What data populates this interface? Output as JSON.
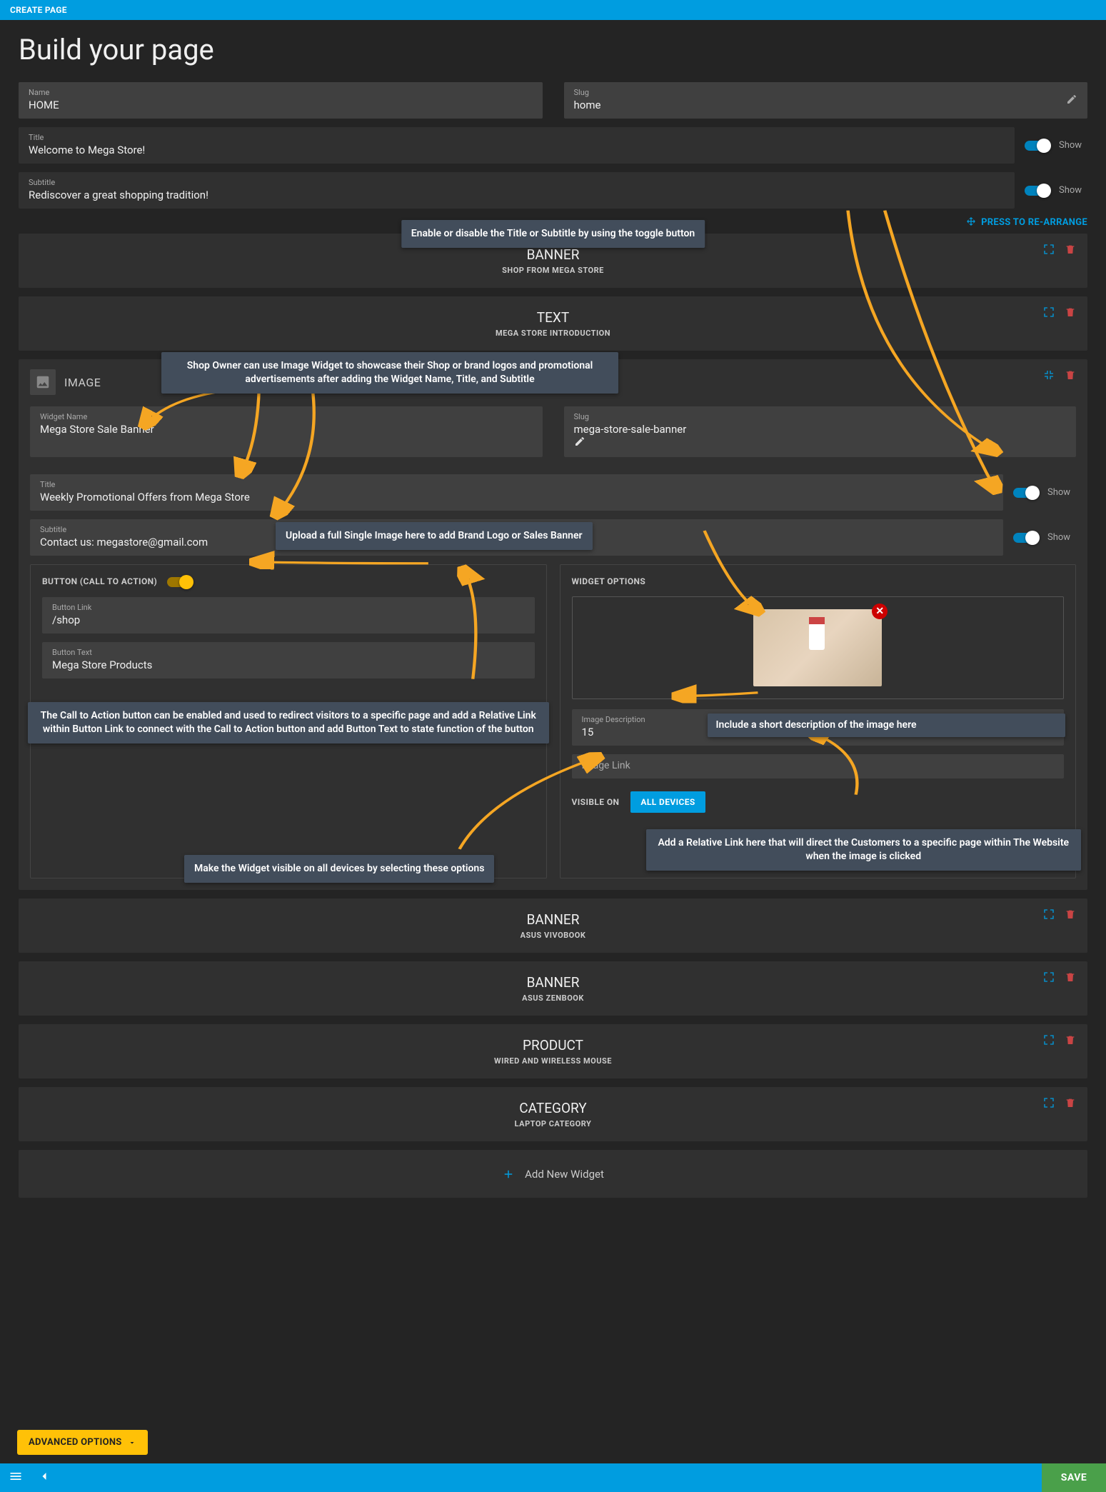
{
  "topbar": {
    "label": "CREATE PAGE"
  },
  "heading": "Build your page",
  "name_field": {
    "label": "Name",
    "value": "HOME"
  },
  "slug_field": {
    "label": "Slug",
    "value": "home"
  },
  "title_field": {
    "label": "Title",
    "value": "Welcome to Mega Store!",
    "show": "Show"
  },
  "subtitle_field": {
    "label": "Subtitle",
    "value": "Rediscover a great shopping tradition!",
    "show": "Show"
  },
  "rearrange": "PRESS TO RE-ARRANGE",
  "widgets": [
    {
      "type": "BANNER",
      "sub": "SHOP FROM MEGA STORE"
    },
    {
      "type": "TEXT",
      "sub": "MEGA STORE INTRODUCTION"
    }
  ],
  "image_widget": {
    "label": "IMAGE",
    "name_f": {
      "label": "Widget Name",
      "value": "Mega Store Sale Banner"
    },
    "slug_f": {
      "label": "Slug",
      "value": "mega-store-sale-banner"
    },
    "title_f": {
      "label": "Title",
      "value": "Weekly Promotional Offers from Mega Store",
      "show": "Show"
    },
    "subtitle_f": {
      "label": "Subtitle",
      "value": "Contact us: megastore@gmail.com",
      "show": "Show"
    },
    "cta": {
      "heading": "BUTTON (CALL TO ACTION)",
      "link": {
        "label": "Button Link",
        "value": "/shop"
      },
      "text": {
        "label": "Button Text",
        "value": "Mega Store Products"
      }
    },
    "opts": {
      "heading": "WIDGET OPTIONS",
      "desc": {
        "label": "Image Description",
        "value": "15"
      },
      "link_label": "Image Link",
      "visible_label": "VISIBLE ON",
      "all_devices": "ALL DEVICES"
    }
  },
  "widgets2": [
    {
      "type": "BANNER",
      "sub": "ASUS VIVOBOOK"
    },
    {
      "type": "BANNER",
      "sub": "ASUS ZENBOOK"
    },
    {
      "type": "PRODUCT",
      "sub": "WIRED AND WIRELESS MOUSE"
    },
    {
      "type": "CATEGORY",
      "sub": "LAPTOP CATEGORY"
    }
  ],
  "add_widget": "Add New Widget",
  "adv_options": "ADVANCED OPTIONS",
  "save": "SAVE",
  "callouts": {
    "toggle": "Enable or disable the Title or Subtitle by using the toggle button",
    "image_head": "Shop Owner can use Image Widget to showcase their Shop or brand logos and promotional advertisements after adding the Widget Name, Title, and Subtitle",
    "upload": "Upload a full Single Image here to add Brand Logo or Sales Banner",
    "cta": "The Call to Action button can be enabled and used to redirect visitors to a specific page and add a Relative Link within Button Link to connect with the Call to Action button and add Button Text to state function of the button",
    "desc": "Include a short description of the image here",
    "imglink": "Add a Relative Link here that will direct the Customers to a specific page within The Website when the image is clicked",
    "visible": "Make the Widget visible on all devices by selecting these options"
  }
}
